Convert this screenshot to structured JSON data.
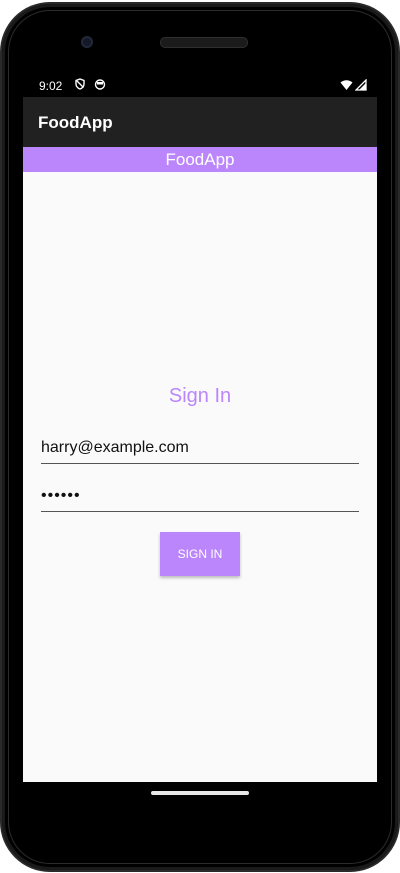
{
  "status_bar": {
    "time": "9:02",
    "left_icons": [
      "shield-icon",
      "notification-face-icon"
    ],
    "right_icons": [
      "wifi-icon",
      "cell-signal-icon"
    ]
  },
  "app_bar": {
    "title": "FoodApp",
    "background": "#212121"
  },
  "banner": {
    "text": "FoodApp",
    "background": "#bb86fc"
  },
  "sign_in": {
    "title": "Sign In",
    "email_value": "harry@example.com",
    "password_value": "••••••",
    "button_label": "SIGN IN",
    "accent": "#bb86fc"
  },
  "navigation": {
    "gesture_icon": "home-pill-icon"
  }
}
